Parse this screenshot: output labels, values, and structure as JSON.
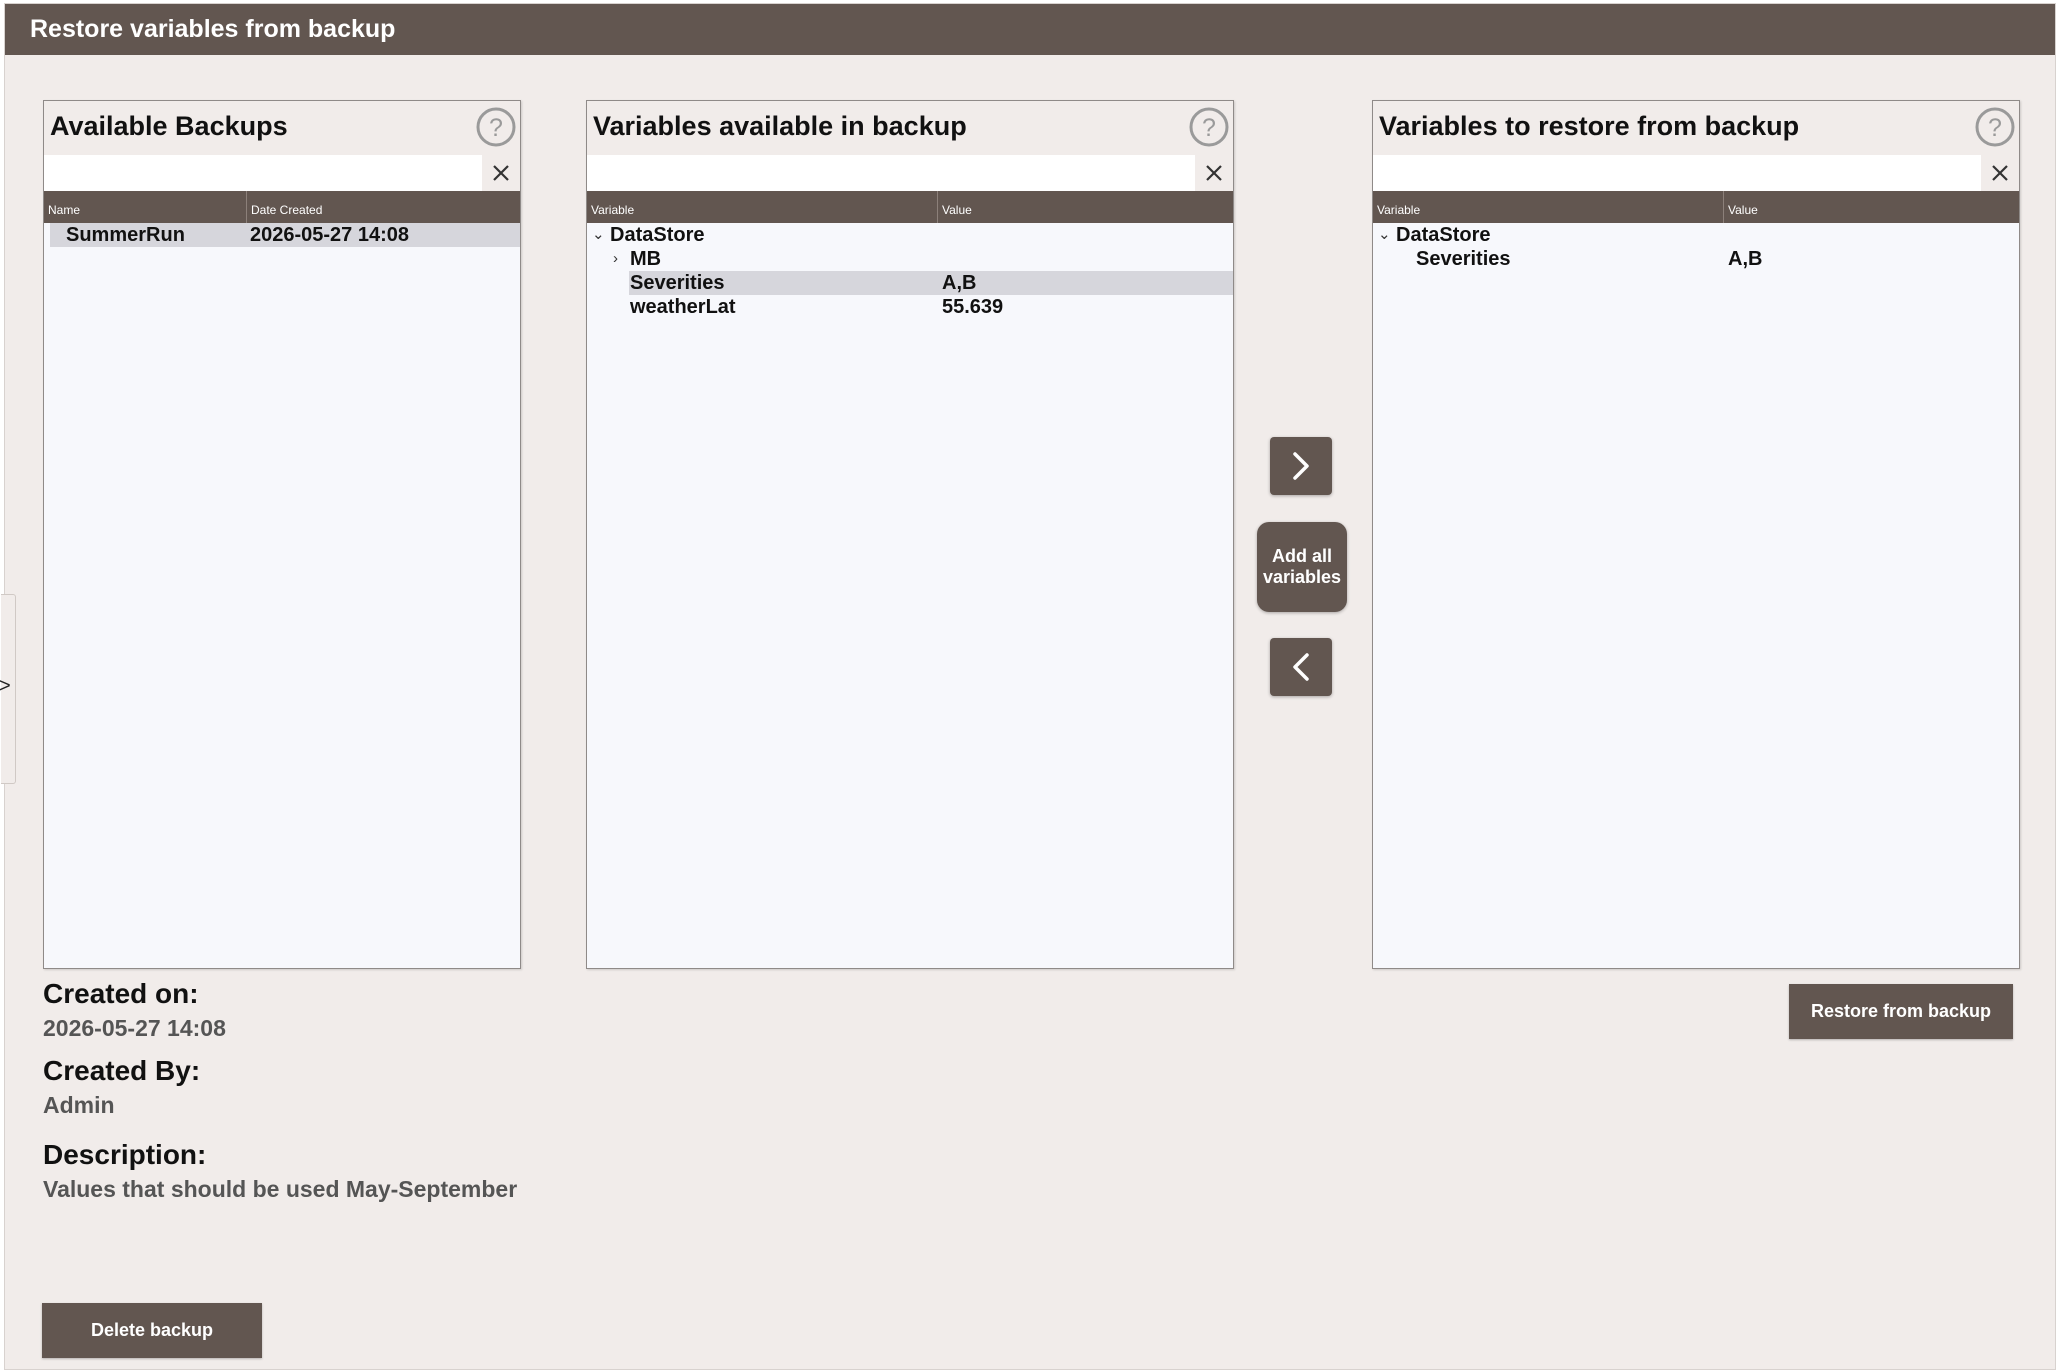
{
  "window": {
    "title": "Restore variables from backup"
  },
  "side_tab": {
    "glyph": ">"
  },
  "backups_panel": {
    "title": "Available Backups",
    "search": {
      "value": "",
      "placeholder": ""
    },
    "columns": [
      "Name",
      "Date Created"
    ],
    "rows": [
      {
        "name": "SummerRun",
        "date": "2026-05-27 14:08",
        "selected": true
      }
    ]
  },
  "available_panel": {
    "title": "Variables available in backup",
    "search": {
      "value": "",
      "placeholder": ""
    },
    "columns": [
      "Variable",
      "Value"
    ],
    "tree": {
      "root": "DataStore",
      "child_folder": "MB",
      "items": [
        {
          "name": "Severities",
          "value": "A,B",
          "selected": true
        },
        {
          "name": "weatherLat",
          "value": "55.639",
          "selected": false
        }
      ]
    }
  },
  "restore_panel": {
    "title": "Variables to restore from backup",
    "search": {
      "value": "",
      "placeholder": ""
    },
    "columns": [
      "Variable",
      "Value"
    ],
    "tree": {
      "root": "DataStore",
      "items": [
        {
          "name": "Severities",
          "value": "A,B"
        }
      ]
    }
  },
  "transfer": {
    "add_all_line1": "Add all",
    "add_all_line2": "variables"
  },
  "details": {
    "created_on_label": "Created on:",
    "created_on_value": "2026-05-27 14:08",
    "created_by_label": "Created By:",
    "created_by_value": "Admin",
    "description_label": "Description:",
    "description_value": "Values that should be used May-September"
  },
  "actions": {
    "restore_label": "Restore from backup",
    "delete_label": "Delete backup"
  },
  "colors": {
    "accent": "#625650",
    "background": "#f1ecea",
    "list_background": "#f7f8fc",
    "selection": "#d6d6dc"
  }
}
